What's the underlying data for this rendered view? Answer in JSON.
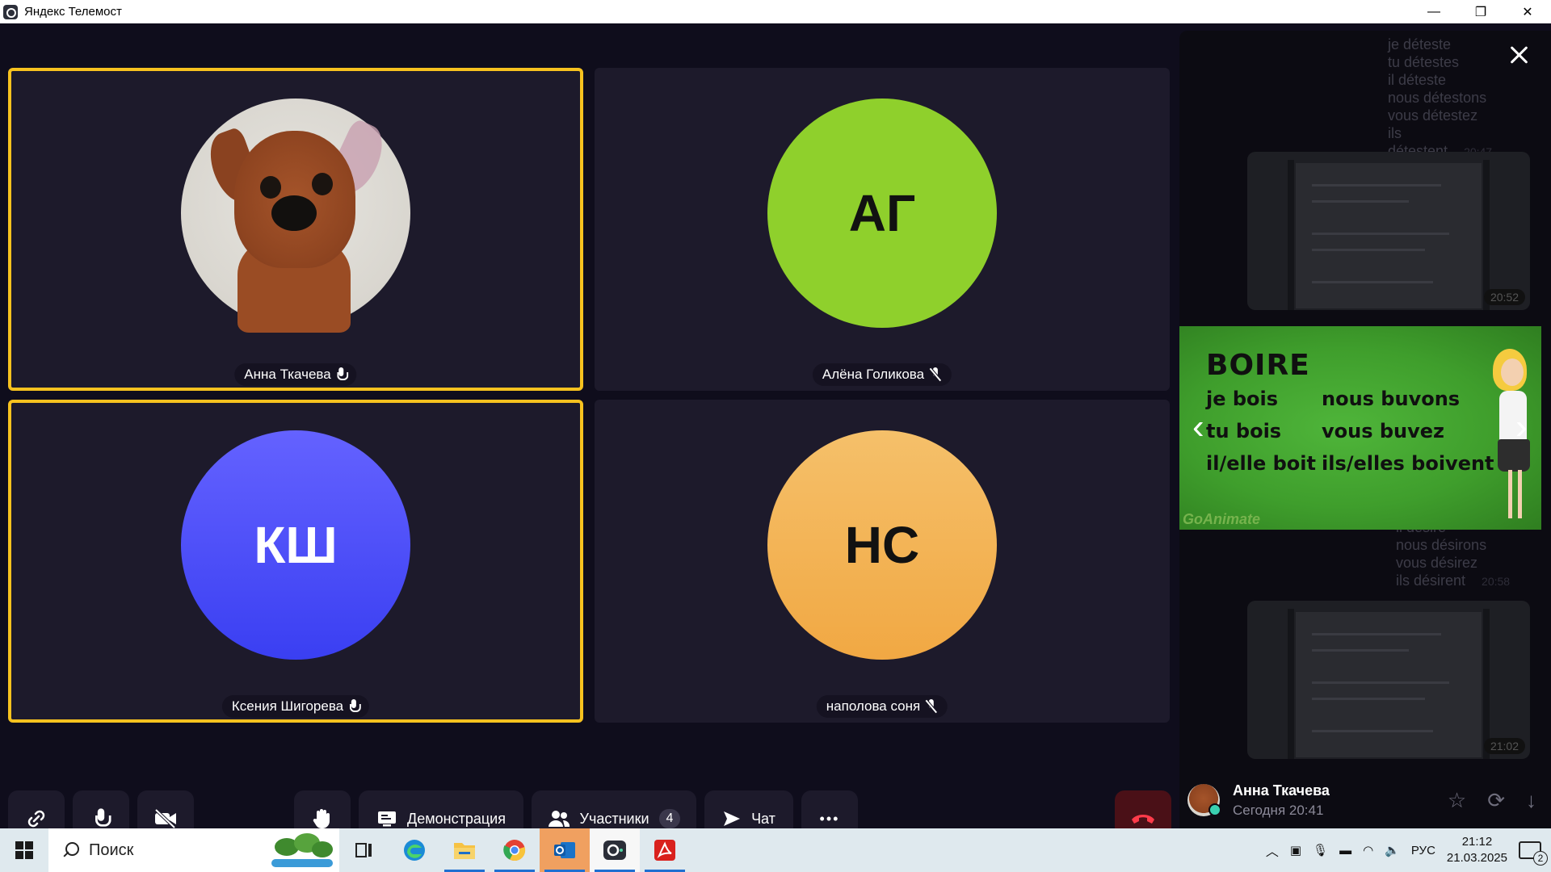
{
  "window": {
    "title": "Яндекс Телемост",
    "minimize": "—",
    "restore": "❐",
    "close": "✕"
  },
  "participants": [
    {
      "name": "Анна Ткачева",
      "initials": "",
      "mic": "on",
      "speaking": true,
      "avatar_type": "photo"
    },
    {
      "name": "Алёна Голикова",
      "initials": "АГ",
      "mic": "off",
      "speaking": false,
      "avatar_color": "#8fd02c"
    },
    {
      "name": "Ксения Шигорева",
      "initials": "КШ",
      "mic": "on",
      "speaking": true,
      "avatar_color": "#4a4cf5"
    },
    {
      "name": "наполова соня",
      "initials": "НС",
      "mic": "off",
      "speaking": false,
      "avatar_color": "#f3b04f"
    }
  ],
  "controls": {
    "link_icon": "link-icon",
    "demo_label": "Демонстрация",
    "participants_label": "Участники",
    "participants_count": "4",
    "chat_label": "Чат",
    "more_label": "•••"
  },
  "chat": {
    "messages": [
      {
        "type": "text",
        "lines": [
          "je déteste",
          "tu détestes",
          "il déteste",
          "nous détestons",
          "vous détestez",
          "ils détestent"
        ],
        "time": "20:47"
      },
      {
        "type": "screenshot",
        "time": "20:52"
      },
      {
        "type": "text",
        "lines": [
          "il désire",
          "nous désirons",
          "vous désirez",
          "ils désirent"
        ],
        "time": "20:58"
      },
      {
        "type": "screenshot",
        "time": "21:02"
      }
    ],
    "video": {
      "title": "BOIRE",
      "left_col": [
        "je bois",
        "tu bois",
        "il/elle boit"
      ],
      "right_col": [
        "nous buvons",
        "vous buvez",
        "ils/elles boivent"
      ],
      "logo": "GoAnimate"
    },
    "footer": {
      "author": "Анна Ткачева",
      "when": "Сегодня 20:41"
    }
  },
  "taskbar": {
    "search_label": "Поиск",
    "lang": "РУС",
    "time": "21:12",
    "date": "21.03.2025",
    "notifications": "2"
  },
  "colors": {
    "speaking_border": "#f7c21f",
    "tile_bg": "#1d1a2b",
    "stage_bg": "#0f0d1c",
    "end_call": "#4a1017"
  }
}
